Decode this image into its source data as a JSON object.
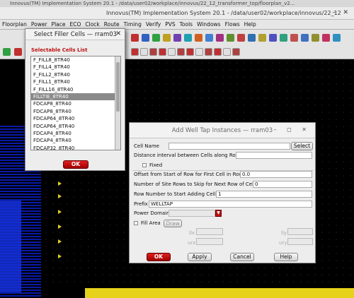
{
  "os_title": "Innovus(TM) Implementation System 20.1 - /data/user02/workplace/innovus/22_12_transformer_top/floorplan_v2...",
  "main_window": {
    "title": "Innovus(TM) Implementation System 20.1 - /data/user02/workplace/innovus/22_12",
    "menu": [
      "Floorplan",
      "Power",
      "Place",
      "ECO",
      "Clock",
      "Route",
      "Timing",
      "Verify",
      "PVS",
      "Tools",
      "Windows",
      "Flows",
      "Help"
    ]
  },
  "filler_dialog": {
    "title": "Select Filler Cells — rram03",
    "close_icon": "close-icon",
    "group_label": "Selectable Cells List",
    "cells": [
      "F_FILL8_8TR40",
      "F_FILL4_8TR40",
      "F_FILL2_8TR40",
      "F_FILL1_8TR40",
      "F_FILL16_8TR40",
      "FILLTIE_8TR40",
      "FDCAP8_8TR40",
      "FDCAP8_8TR40",
      "FDCAP64_8TR40",
      "FDCAP64_8TR40",
      "FDCAP4_8TR40",
      "FDCAP4_8TR40",
      "FDCAP32_8TR40"
    ],
    "selected_index": 5,
    "ok_label": "OK"
  },
  "welltap_dialog": {
    "title": "Add Well Tap Instances — rram03",
    "controls": "– ◻ ✕",
    "cell_name_label": "Cell Name",
    "cell_name_value": "",
    "select_label": "Select",
    "distance_label": "Distance interval between Cells along Row",
    "fixed_label": "Fixed",
    "offset_label": "Offset from Start of Row for First Cell in Row",
    "offset_value": "0.0",
    "skip_label": "Number of Site Rows to Skip for Next Row of Cells",
    "skip_value": "0",
    "row_number_label": "Row Number to Start Adding Cells",
    "row_number_value": "1",
    "prefix_label": "Prefix",
    "prefix_value": "WELLTAP",
    "power_domain_label": "Power Domain:",
    "power_domain_value": "",
    "fill_area_label": "Fill Area",
    "draw_label": "Draw",
    "llx_label": "llx",
    "lly_label": "lly",
    "urx_label": "urx",
    "ury_label": "ury",
    "ok_label": "OK",
    "apply_label": "Apply",
    "cancel_label": "Cancel",
    "help_label": "Help"
  },
  "colors": {
    "accent_red": "#c01010",
    "row_blue": "#0a1aa8",
    "pin_yellow": "#e0d020"
  }
}
